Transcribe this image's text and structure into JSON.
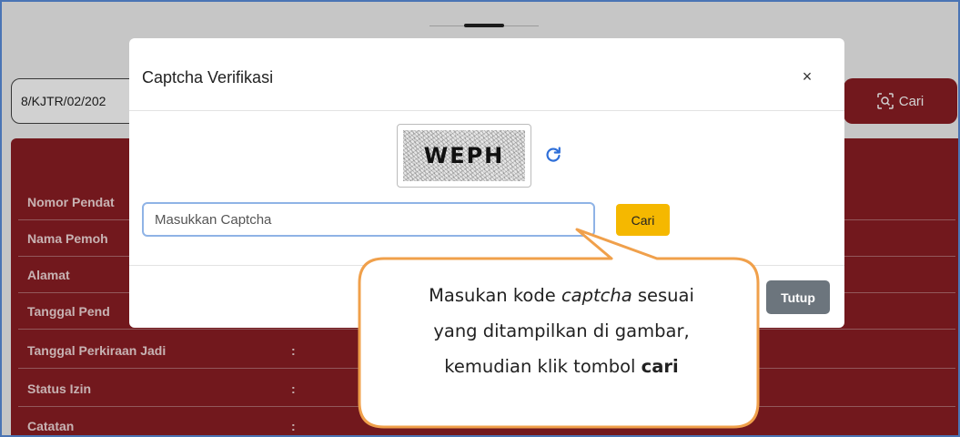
{
  "background": {
    "search_value": "8/KJTR/02/202",
    "search_button_label": "Cari",
    "rows": [
      {
        "label": "Nomor Pendat",
        "colon": ""
      },
      {
        "label": "Nama Pemoh",
        "colon": ""
      },
      {
        "label": "Alamat",
        "colon": ""
      },
      {
        "label": "Tanggal Pend",
        "colon": ""
      },
      {
        "label": "Tanggal Perkiraan Jadi",
        "colon": ":"
      },
      {
        "label": "Status Izin",
        "colon": ":"
      },
      {
        "label": "Catatan",
        "colon": ":"
      }
    ]
  },
  "modal": {
    "title": "Captcha Verifikasi",
    "close_symbol": "×",
    "captcha_text": "WEPH",
    "input_placeholder": "Masukkan Captcha",
    "search_label": "Cari",
    "close_label": "Tutup"
  },
  "callout": {
    "line1_pre": "Masukan kode ",
    "line1_em": "captcha",
    "line1_post": " sesuai",
    "line2": "yang ditampilkan di gambar,",
    "line3_pre": "kemudian klik tombol ",
    "line3_bold": "cari"
  },
  "colors": {
    "brand_red": "#8b1e24",
    "accent_yellow": "#f5b800",
    "secondary_gray": "#6c757d",
    "callout_orange": "#f0a04b",
    "refresh_blue": "#2f6fd8"
  }
}
